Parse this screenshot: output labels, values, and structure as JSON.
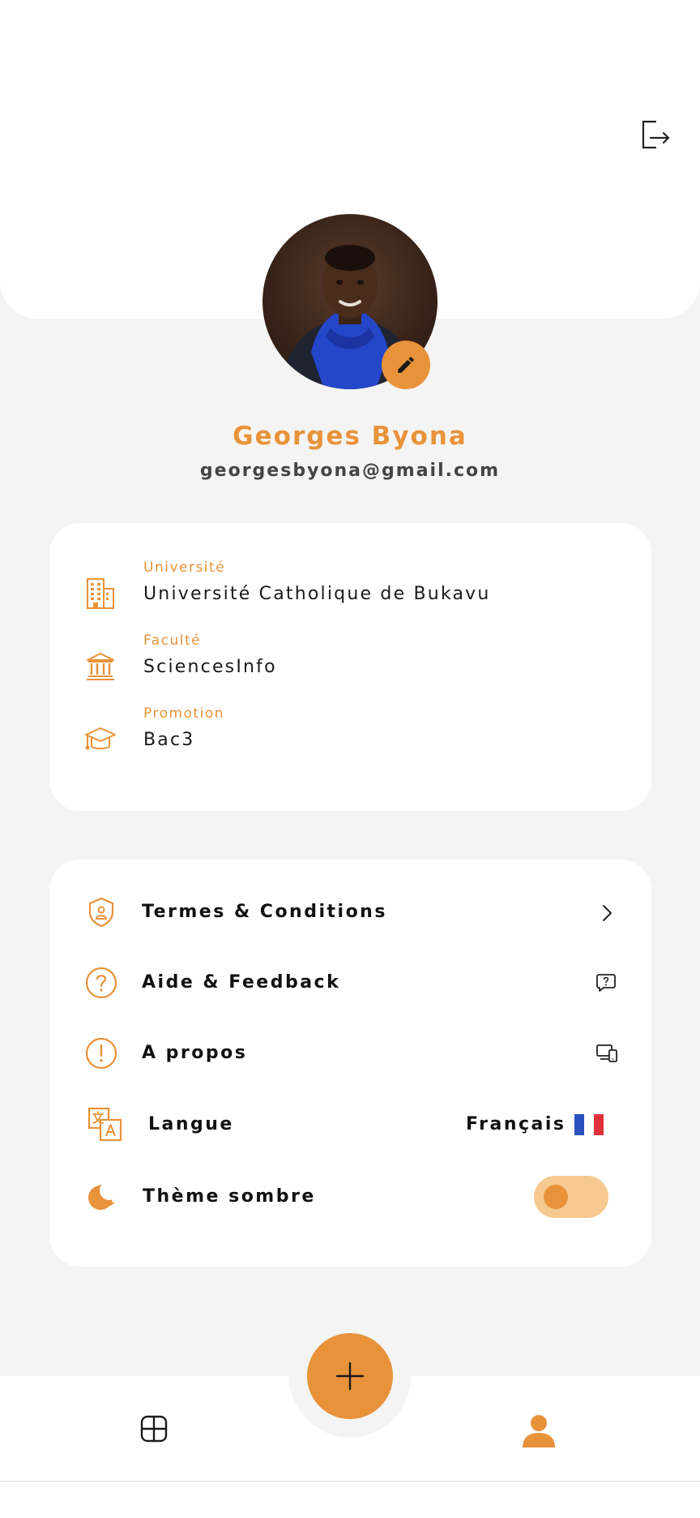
{
  "profile": {
    "name": "Georges Byona",
    "email": "georgesbyona@gmail.com",
    "avatar_alt": "Georges Byona"
  },
  "academic": [
    {
      "label": "Université",
      "value": "Université Catholique de Bukavu",
      "icon": "building-icon"
    },
    {
      "label": "Faculté",
      "value": "SciencesInfo",
      "icon": "institution-icon"
    },
    {
      "label": "Promotion",
      "value": "Bac3",
      "icon": "graduation-cap-icon"
    }
  ],
  "menu": {
    "terms": {
      "label": "Termes & Conditions",
      "icon": "shield-user-icon",
      "trailing_icon": "chevron-right-icon"
    },
    "help": {
      "label": "Aide & Feedback",
      "icon": "question-circle-icon",
      "trailing_icon": "help-message-icon"
    },
    "about": {
      "label": "A propos",
      "icon": "exclamation-circle-icon",
      "trailing_icon": "devices-icon"
    },
    "language": {
      "label": "Langue",
      "value": "Français",
      "icon": "translate-icon",
      "trailing_icon": "flag-fr-icon"
    },
    "theme": {
      "label": "Thème sombre",
      "icon": "moon-icon",
      "toggle_on": false
    }
  },
  "colors": {
    "accent": "#e8923a",
    "accent_light": "#f5c98f",
    "background": "#f4f4f4",
    "card": "#ffffff",
    "flag": [
      "#2a52be",
      "#ffffff",
      "#e0303a"
    ]
  },
  "nav": {
    "items": [
      {
        "name": "dashboard",
        "icon": "grid-icon",
        "active": false
      },
      {
        "name": "profile",
        "icon": "user-icon",
        "active": true
      }
    ],
    "fab_icon": "plus-icon"
  }
}
